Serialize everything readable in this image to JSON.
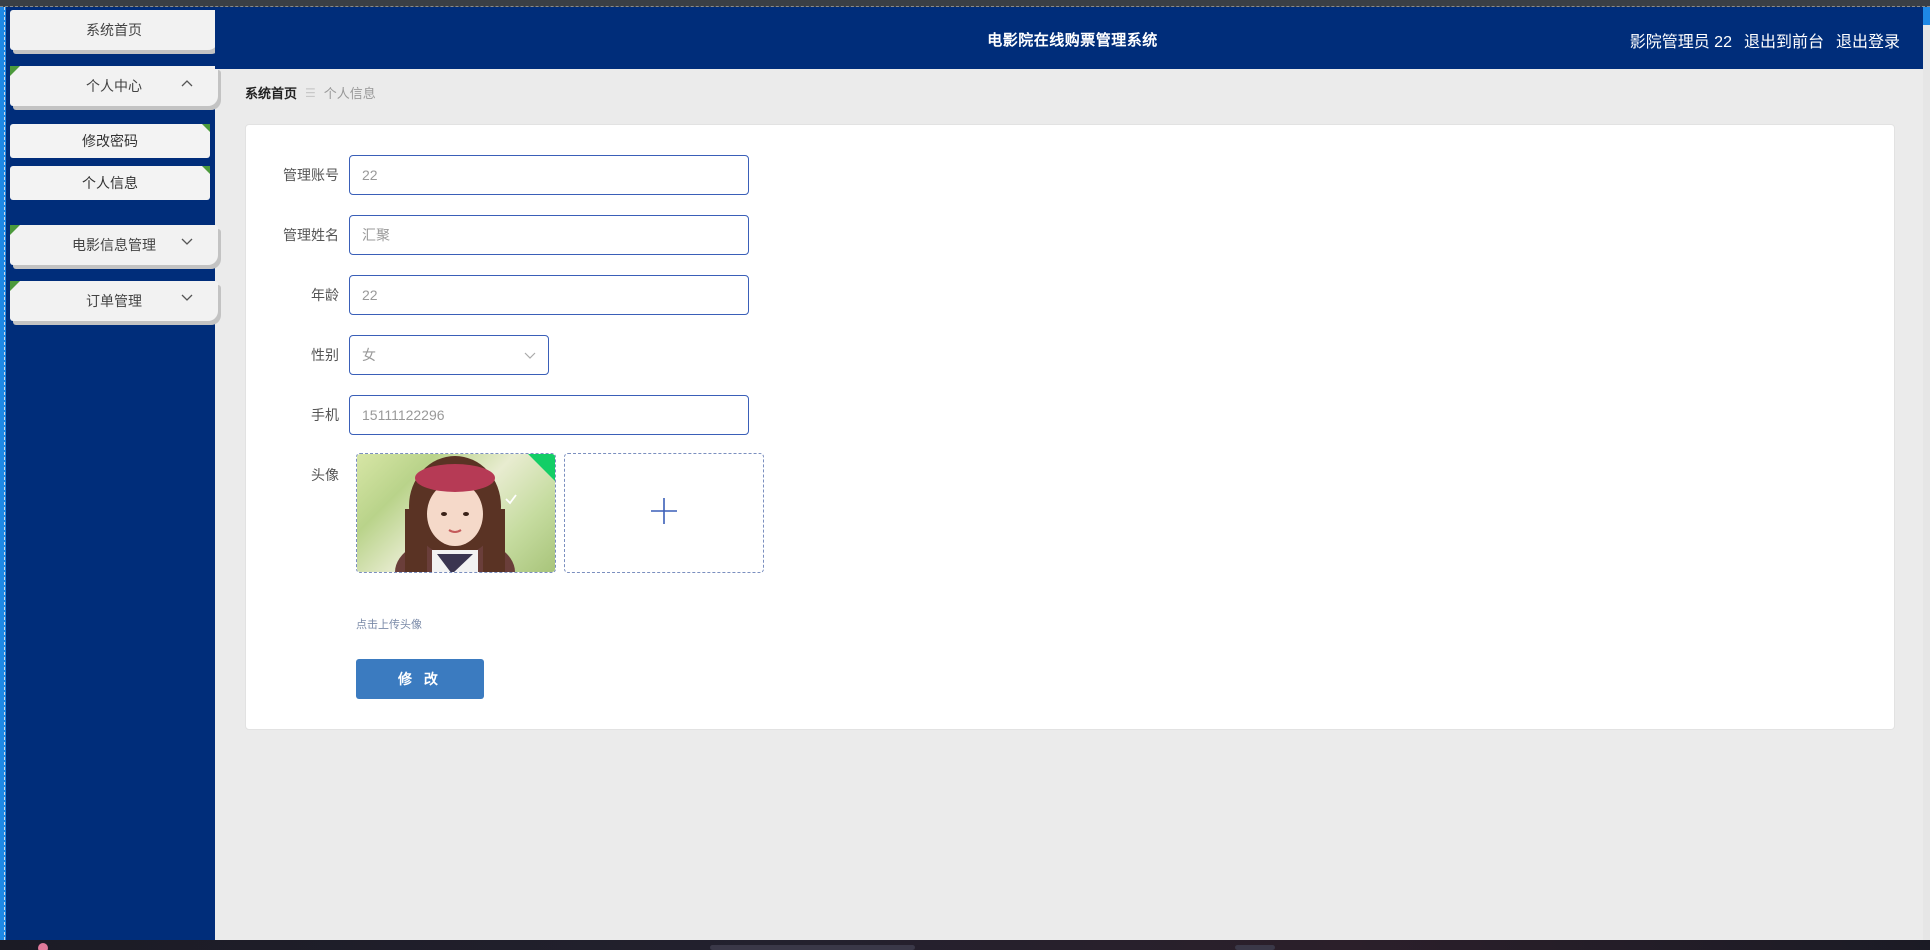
{
  "header": {
    "title": "电影院在线购票管理系统",
    "user_label": "影院管理员 22",
    "goto_front": "退出到前台",
    "logout": "退出登录"
  },
  "sidebar": {
    "items": [
      {
        "label": "系统首页"
      },
      {
        "label": "个人中心",
        "expanded": true,
        "children": [
          {
            "label": "修改密码"
          },
          {
            "label": "个人信息"
          }
        ]
      },
      {
        "label": "电影信息管理",
        "expanded": false
      },
      {
        "label": "订单管理",
        "expanded": false
      }
    ]
  },
  "breadcrumb": {
    "home": "系统首页",
    "separator": "☰",
    "current": "个人信息"
  },
  "form": {
    "account": {
      "label": "管理账号",
      "value": "22"
    },
    "name": {
      "label": "管理姓名",
      "value": "汇聚"
    },
    "age": {
      "label": "年龄",
      "value": "22"
    },
    "gender": {
      "label": "性别",
      "value": "女"
    },
    "phone": {
      "label": "手机",
      "value": "15111122296"
    },
    "avatar": {
      "label": "头像",
      "tip": "点击上传头像"
    },
    "submit_label": "修 改"
  },
  "colors": {
    "sidebar_bg": "#002d7a",
    "header_bg": "#002d7a",
    "accent": "#3b7bc0",
    "menu_corner": "#4c9a3c",
    "upload_success": "#13ce66"
  },
  "icons": {
    "chevron_up": "chevron-up-icon",
    "chevron_down": "chevron-down-icon",
    "plus": "plus-icon",
    "check": "check-icon"
  }
}
